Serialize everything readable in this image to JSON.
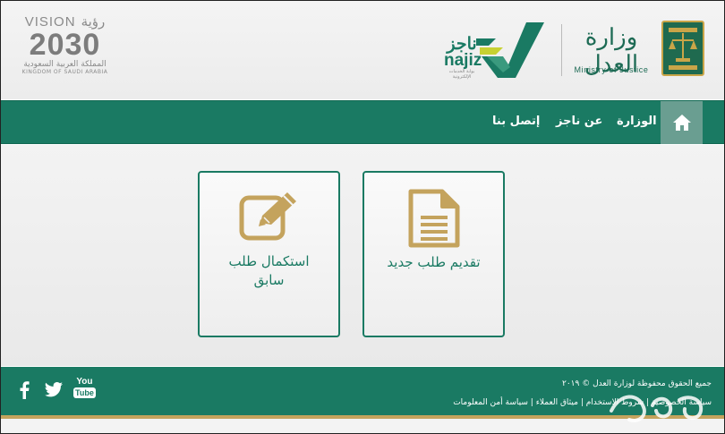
{
  "header": {
    "vision": {
      "word": "VISION",
      "arabic_word": "رؤية",
      "year": "2030",
      "arabic_country": "المملكة العربية السعودية",
      "country": "KINGDOM OF SAUDI ARABIA"
    },
    "najiz": {
      "arabic": "ناجز",
      "latin": "najiz",
      "tagline": "بوابة الخدمات الإلكترونية"
    },
    "ministry": {
      "arabic": "وزارة العدل",
      "english": "Ministry of Justice"
    }
  },
  "nav": {
    "home_icon": "home-icon",
    "items": [
      "الوزارة",
      "عن ناجز",
      "إتصل بنا"
    ]
  },
  "cards": [
    {
      "label": "تقديم طلب جديد",
      "icon": "document-icon"
    },
    {
      "label_line1": "استكمال طلب",
      "label_line2": "سابق",
      "icon": "edit-icon"
    }
  ],
  "footer": {
    "copyright": "جميع الحقوق محفوظة لوزارة العدل © ٢٠١٩",
    "links": [
      "سياسة الخصوصية",
      "شروط الاستخدام",
      "ميثاق العملاء",
      "سياسة أمن المعلومات"
    ],
    "separator": "|",
    "social": {
      "youtube_top": "You",
      "youtube_bottom": "Tube"
    }
  },
  "colors": {
    "primary": "#1a7a63",
    "gold": "#c4a35d",
    "home_bg": "#6a9e91"
  }
}
